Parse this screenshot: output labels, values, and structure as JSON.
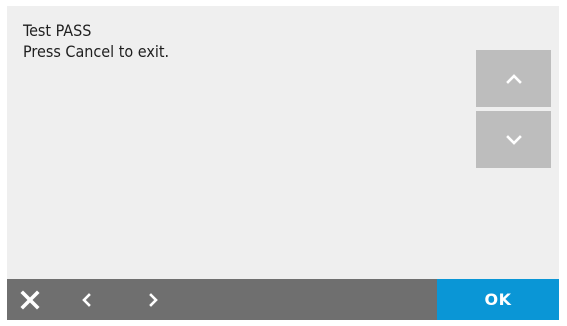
{
  "message": {
    "line1": "Test PASS",
    "line2": "Press Cancel to exit."
  },
  "scroll": {
    "up_icon": "chevron-up-icon",
    "down_icon": "chevron-down-icon"
  },
  "bottom_bar": {
    "cancel_icon": "close-icon",
    "back_icon": "chevron-left-icon",
    "forward_icon": "chevron-right-icon",
    "ok_label": "OK"
  },
  "colors": {
    "screen_background": "#efefef",
    "scroll_button": "#bdbdbd",
    "bottom_bar": "#6f6f6f",
    "ok_button": "#0a96d6",
    "text": "#1f1f1f"
  }
}
